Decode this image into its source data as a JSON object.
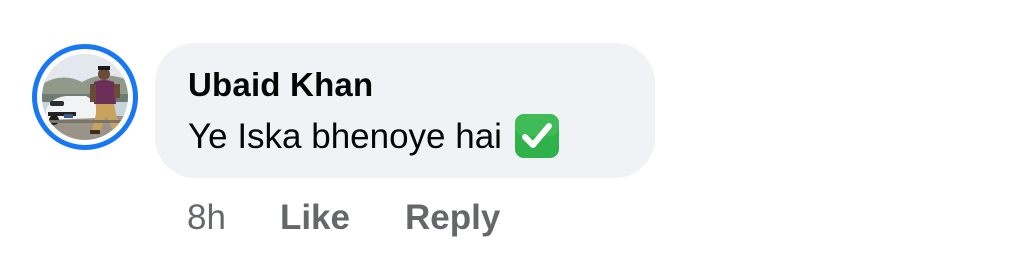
{
  "comment": {
    "author": "Ubaid Khan",
    "text": "Ye Iska bhenoye hai",
    "emoji": "white-check-mark-emoji",
    "timestamp": "8h",
    "actions": {
      "like": "Like",
      "reply": "Reply"
    }
  },
  "colors": {
    "avatar_ring": "#1877f2",
    "bubble_background": "#f0f2f5",
    "primary_text": "#050505",
    "secondary_text": "#65676b",
    "check_emoji_green": "#2fb24a"
  }
}
